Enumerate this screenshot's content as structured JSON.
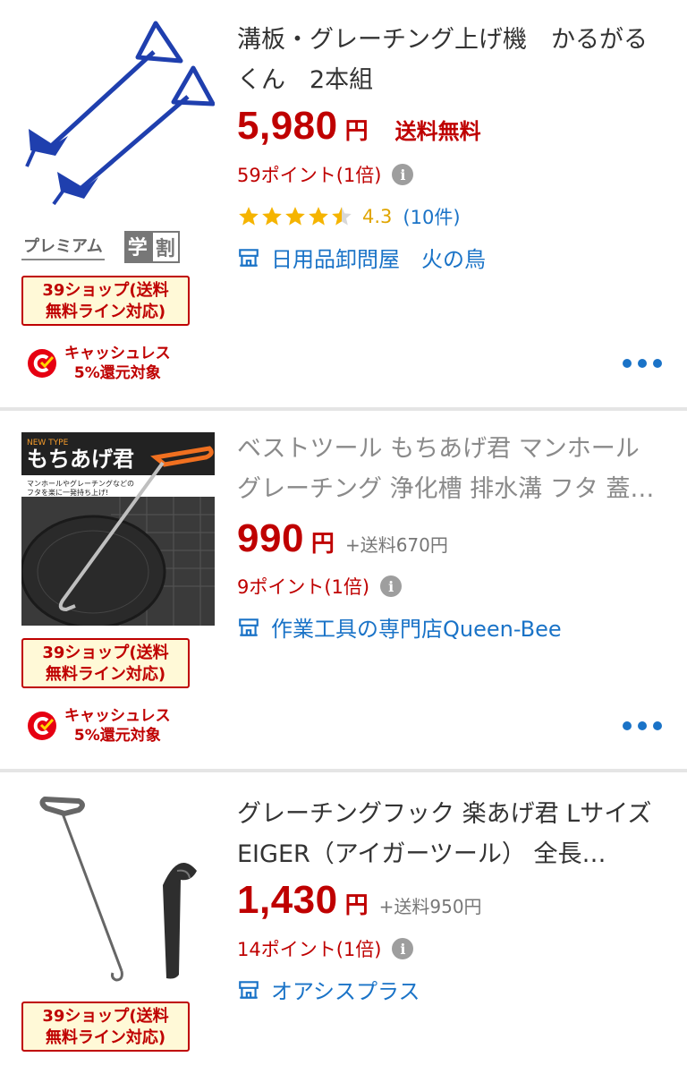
{
  "colors": {
    "price_red": "#bf0000",
    "link_blue": "#1a73c7",
    "star_yellow": "#f5b400",
    "badge_bg": "#fff9d7",
    "divider": "#e5e5e5"
  },
  "items": [
    {
      "title": "溝板・グレーチング上げ機　かるがるくん　2本組",
      "price": "5,980",
      "yen": "円",
      "shipping": "送料無料",
      "points": "59ポイント(1倍)",
      "rating": {
        "stars": 4.5,
        "score": "4.3",
        "count": "(10件)"
      },
      "shop": "日用品卸問屋　火の鳥",
      "badges": {
        "premium": "プレミアム",
        "gakuwari_1": "学",
        "gakuwari_2": "割"
      },
      "shop39": [
        "39ショップ(送料",
        "無料ライン対応)"
      ],
      "cashless": [
        "キャッシュレス",
        "5%還元対象"
      ],
      "icons": {
        "info": "info-icon",
        "shop": "shop-icon",
        "more": "more-icon"
      }
    },
    {
      "title": "ベストツール もちあげ君 マンホール グレーチング 浄化槽 排水溝 フタ 蓋…",
      "price": "990",
      "yen": "円",
      "shipping": "+送料670円",
      "points": "9ポイント(1倍)",
      "shop": "作業工具の専門店Queen-Bee",
      "shop39": [
        "39ショップ(送料",
        "無料ライン対応)"
      ],
      "cashless": [
        "キャッシュレス",
        "5%還元対象"
      ],
      "image_text": {
        "brand": "もちあげ君",
        "tag": "NEW TYPE",
        "caption": "マンホールやグレーチングなどの",
        "caption2": "フタを楽に一発持ち上げ!"
      }
    },
    {
      "title": "グレーチングフック 楽あげ君 Lサイズ EIGER（アイガーツール） 全長…",
      "price": "1,430",
      "yen": "円",
      "shipping": "+送料950円",
      "points": "14ポイント(1倍)",
      "shop": "オアシスプラス",
      "shop39": [
        "39ショップ(送料",
        "無料ライン対応)"
      ]
    }
  ]
}
